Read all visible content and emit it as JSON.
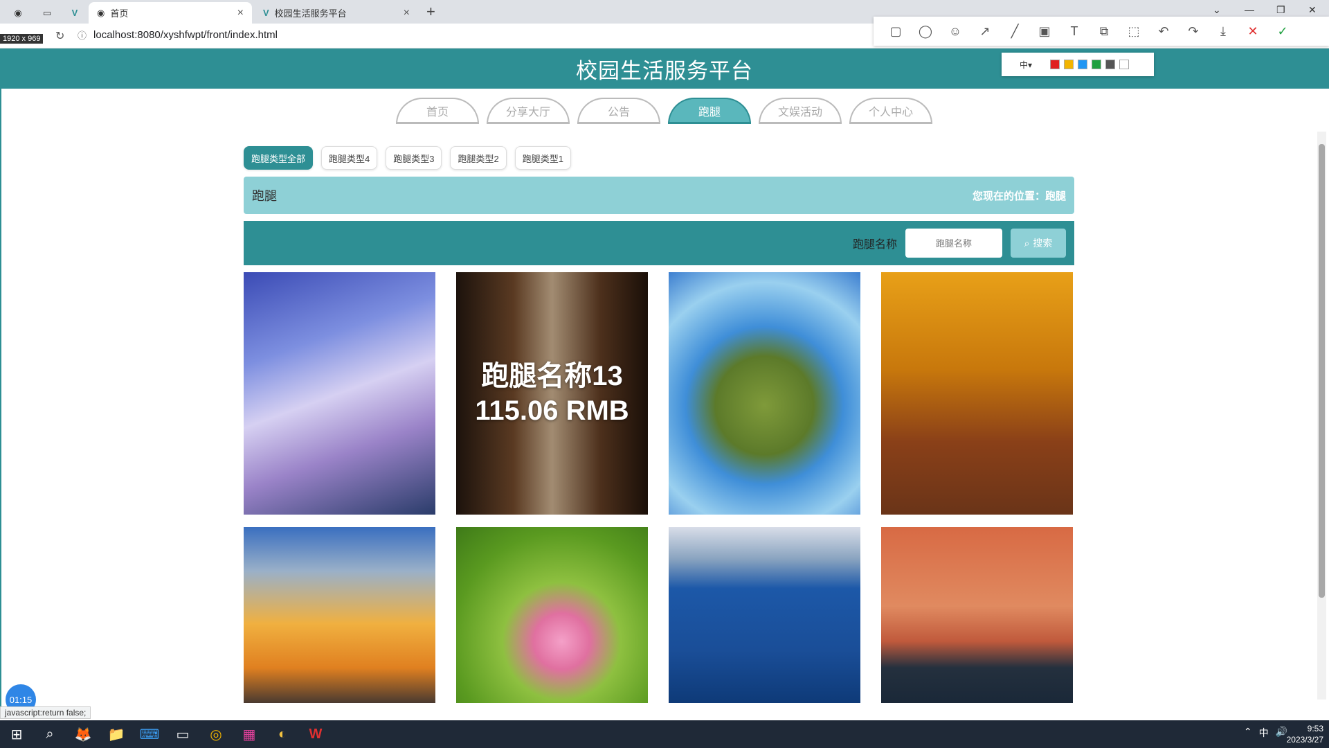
{
  "browser": {
    "tabs": [
      {
        "label": "首页",
        "active": true
      },
      {
        "label": "校园生活服务平台",
        "active": false
      }
    ],
    "tab_close": "×",
    "new_tab": "+",
    "window_controls": [
      "⌄",
      "—",
      "❐",
      "✕"
    ],
    "nav_buttons": [
      "←",
      "→",
      "↻"
    ],
    "dimensions_badge": "1920 x 969",
    "url": "localhost:8080/xyshfwpt/front/index.html",
    "status_url": "javascript:return false;"
  },
  "snip_tool": {
    "tools": [
      "▢",
      "◯",
      "☺",
      "↗",
      "╱",
      "▣",
      "T",
      "⧉",
      "⬚",
      "↶",
      "↷",
      "⤓"
    ],
    "cancel": "✕",
    "confirm": "✓",
    "size_label": "中▾",
    "colors": [
      "#e02020",
      "#f2b400",
      "#2196f3",
      "#20a040",
      "#555555",
      "#ffffff"
    ]
  },
  "site": {
    "title": "校园生活服务平台",
    "nav": [
      {
        "label": "首页",
        "active": false
      },
      {
        "label": "分享大厅",
        "active": false
      },
      {
        "label": "公告",
        "active": false
      },
      {
        "label": "跑腿",
        "active": true
      },
      {
        "label": "文娱活动",
        "active": false
      },
      {
        "label": "个人中心",
        "active": false
      }
    ],
    "categories": [
      {
        "label": "跑腿类型全部",
        "active": true
      },
      {
        "label": "跑腿类型4",
        "active": false
      },
      {
        "label": "跑腿类型3",
        "active": false
      },
      {
        "label": "跑腿类型2",
        "active": false
      },
      {
        "label": "跑腿类型1",
        "active": false
      }
    ],
    "breadcrumb": {
      "title": "跑腿",
      "location": "您现在的位置：跑腿"
    },
    "search": {
      "label": "跑腿名称",
      "placeholder": "跑腿名称",
      "button": "搜索"
    },
    "cards": [
      {
        "image": "sky-clouds"
      },
      {
        "image": "wooden-corridor",
        "name": "跑腿名称13",
        "price": "115.06 RMB"
      },
      {
        "image": "tiny-planet"
      },
      {
        "image": "autumn-trees"
      },
      {
        "image": "sunset-rainbow"
      },
      {
        "image": "pink-lotus"
      },
      {
        "image": "blue-lake"
      },
      {
        "image": "moon-sunset"
      }
    ]
  },
  "overlay": {
    "timer": "01:15"
  },
  "taskbar": {
    "icons": [
      "⊞",
      "⌕",
      "🦊",
      "📁",
      "⌨",
      "▭",
      "◎",
      "▦",
      "◐",
      "W"
    ],
    "tray": [
      "⌃",
      "中",
      "🔊"
    ],
    "time": "9:53",
    "date": "2023/3/27"
  }
}
